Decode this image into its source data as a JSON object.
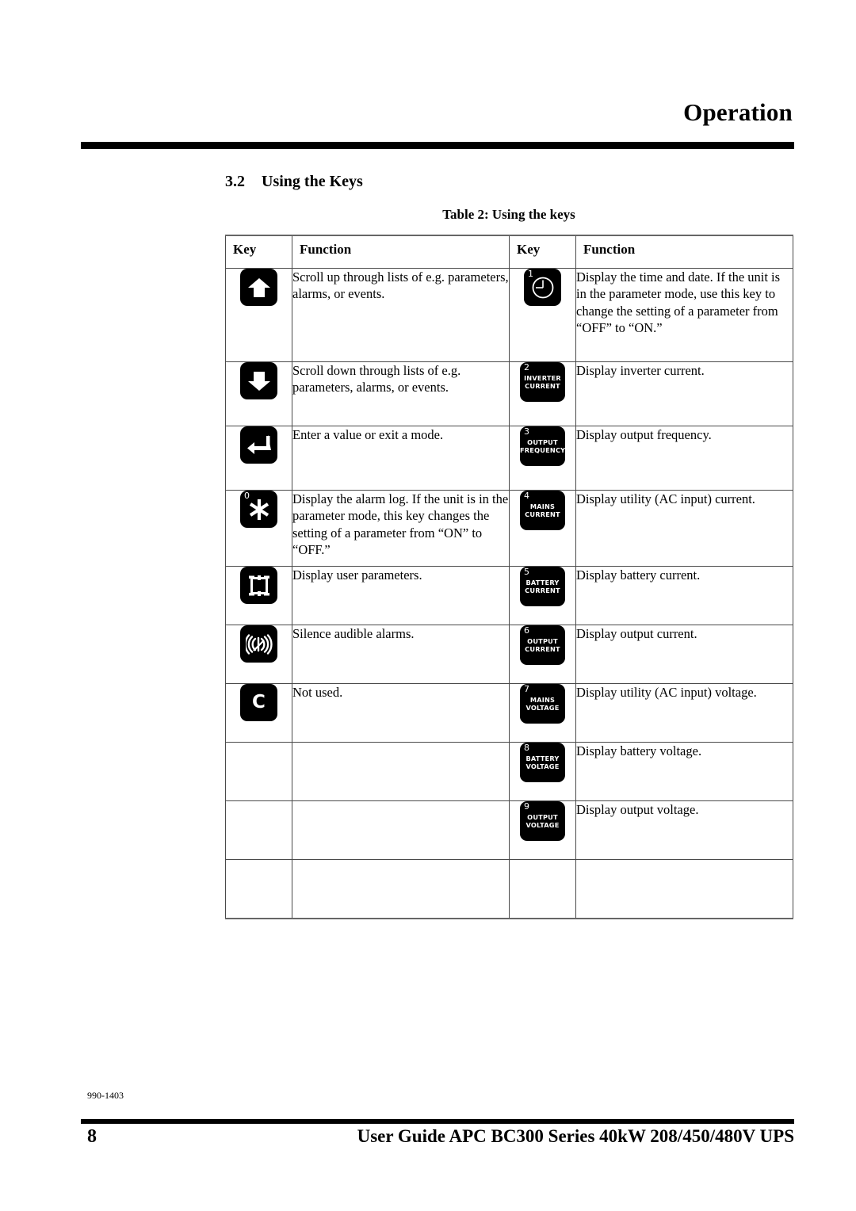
{
  "header": {
    "chapter_title": "Operation"
  },
  "section": {
    "number": "3.2",
    "title": "Using the Keys"
  },
  "table": {
    "caption": "Table 2: Using the keys",
    "columns": [
      "Key",
      "Function",
      "Key",
      "Function"
    ],
    "rows": [
      {
        "left_key": {
          "icon": "arrow-up-key",
          "glyph": "up-arrow",
          "corner": "",
          "label_lines": []
        },
        "left_function": "Scroll up through lists of e.g. parameters, alarms, or events.",
        "right_key": {
          "icon": "clock-key",
          "glyph": "clock-face",
          "corner": "1",
          "label_lines": []
        },
        "right_function": "Display the time and date. If the unit is in the parameter mode, use this key to change the setting of a parameter from “OFF” to “ON.”"
      },
      {
        "left_key": {
          "icon": "arrow-down-key",
          "glyph": "down-arrow",
          "corner": "",
          "label_lines": []
        },
        "left_function": "Scroll down through lists of e.g. parameters, alarms, or events.",
        "right_key": {
          "icon": "inverter-current-key",
          "glyph": "",
          "corner": "2",
          "label_lines": [
            "INVERTER",
            "CURRENT"
          ]
        },
        "right_function": "Display inverter current."
      },
      {
        "left_key": {
          "icon": "enter-key",
          "glyph": "enter-arrow",
          "corner": "",
          "label_lines": []
        },
        "left_function": "Enter a value or exit a mode.",
        "right_key": {
          "icon": "output-frequency-key",
          "glyph": "",
          "corner": "3",
          "label_lines": [
            "OUTPUT",
            "FREQUENCY"
          ]
        },
        "right_function": "Display output frequency."
      },
      {
        "left_key": {
          "icon": "asterisk-key",
          "glyph": "asterisk",
          "corner": "0",
          "label_lines": []
        },
        "left_function": "Display the alarm log. If the unit is in the parameter mode, this key changes the setting of a parameter from “ON” to “OFF.”",
        "right_key": {
          "icon": "mains-current-key",
          "glyph": "",
          "corner": "4",
          "label_lines": [
            "MAINS",
            "CURRENT"
          ]
        },
        "right_function": "Display utility (AC input) current."
      },
      {
        "left_key": {
          "icon": "user-parameters-key",
          "glyph": "square-frame",
          "corner": "",
          "label_lines": []
        },
        "left_function": "Display user parameters.",
        "right_key": {
          "icon": "battery-current-key",
          "glyph": "",
          "corner": "5",
          "label_lines": [
            "BATTERY",
            "CURRENT"
          ]
        },
        "right_function": "Display battery current."
      },
      {
        "left_key": {
          "icon": "alarm-silence-key",
          "glyph": "sound-waves",
          "corner": "",
          "label_lines": []
        },
        "left_function": "Silence audible alarms.",
        "right_key": {
          "icon": "output-current-key",
          "glyph": "",
          "corner": "6",
          "label_lines": [
            "OUTPUT",
            "CURRENT"
          ]
        },
        "right_function": "Display output current."
      },
      {
        "left_key": {
          "icon": "c-key",
          "glyph": "letter-c",
          "corner": "",
          "label_lines": []
        },
        "left_function": "Not used.",
        "right_key": {
          "icon": "mains-voltage-key",
          "glyph": "",
          "corner": "7",
          "label_lines": [
            "MAINS",
            "VOLTAGE"
          ]
        },
        "right_function": "Display utility (AC input) voltage."
      },
      {
        "left_key": null,
        "left_function": "",
        "right_key": {
          "icon": "battery-voltage-key",
          "glyph": "",
          "corner": "8",
          "label_lines": [
            "BATTERY",
            "VOLTAGE"
          ]
        },
        "right_function": "Display battery voltage."
      },
      {
        "left_key": null,
        "left_function": "",
        "right_key": {
          "icon": "output-voltage-key",
          "glyph": "",
          "corner": "9",
          "label_lines": [
            "OUTPUT",
            "VOLTAGE"
          ]
        },
        "right_function": "Display output voltage."
      },
      {
        "left_key": null,
        "left_function": "",
        "right_key": null,
        "right_function": ""
      }
    ]
  },
  "footer": {
    "doc_number": "990-1403",
    "page_number": "8",
    "title": "User Guide APC  BC300 Series 40kW 208/450/480V UPS"
  }
}
